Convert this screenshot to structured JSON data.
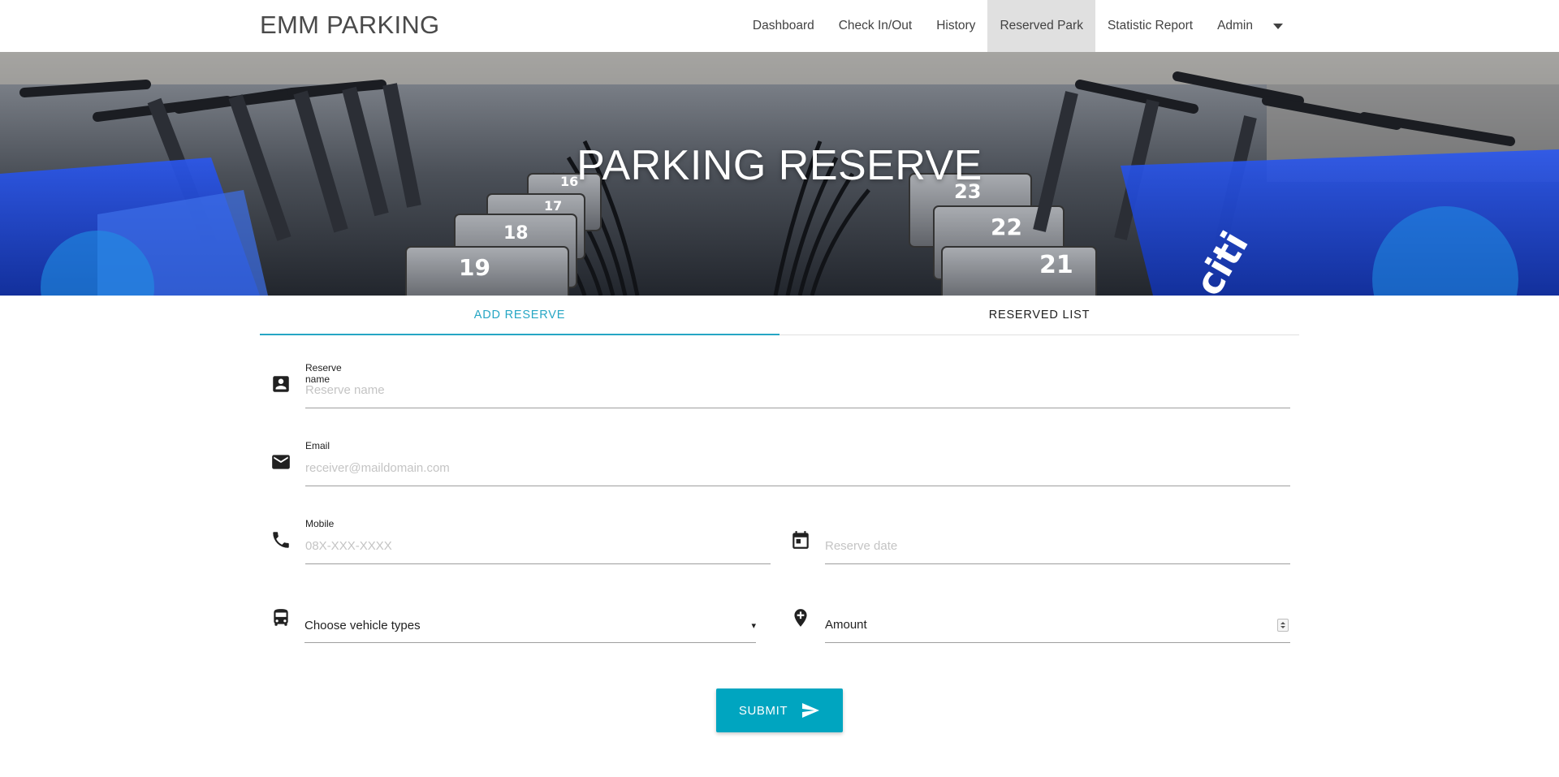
{
  "navbar": {
    "brand": "EMM PARKING",
    "items": [
      {
        "label": "Dashboard",
        "active": false
      },
      {
        "label": "Check In/Out",
        "active": false
      },
      {
        "label": "History",
        "active": false
      },
      {
        "label": "Reserved Park",
        "active": true
      },
      {
        "label": "Statistic Report",
        "active": false
      },
      {
        "label": "Admin",
        "active": false
      }
    ],
    "dropdown_icon": "caret-down-icon"
  },
  "hero": {
    "title": "PARKING RESERVE",
    "image": "bike-share-dock-photo",
    "slot_numbers": [
      "16",
      "17",
      "18",
      "19",
      "23",
      "22",
      "21"
    ],
    "sign_text": "citi"
  },
  "tabs": [
    {
      "label": "ADD RESERVE",
      "active": true
    },
    {
      "label": "RESERVED LIST",
      "active": false
    }
  ],
  "form": {
    "reserve_name": {
      "label": "Reserve name",
      "placeholder": "Reserve name",
      "icon": "contact-card-icon"
    },
    "email": {
      "label": "Email",
      "placeholder": "receiver@maildomain.com",
      "icon": "mail-icon"
    },
    "mobile": {
      "label": "Mobile",
      "placeholder": "08X-XXX-XXXX",
      "icon": "phone-icon"
    },
    "reserve_date": {
      "placeholder": "Reserve date",
      "icon": "calendar-icon"
    },
    "vehicle_type": {
      "selected": "Choose vehicle types",
      "icon": "bus-icon",
      "arrow": "▾"
    },
    "amount": {
      "placeholder": "Amount",
      "icon": "add-location-icon"
    },
    "submit": {
      "label": "SUBMIT",
      "icon": "send-icon"
    }
  },
  "colors": {
    "accent": "#26a6c4",
    "button": "#00a5c0",
    "active_nav": "#e0e0e0",
    "bike_blue": "#1a3fd6"
  }
}
